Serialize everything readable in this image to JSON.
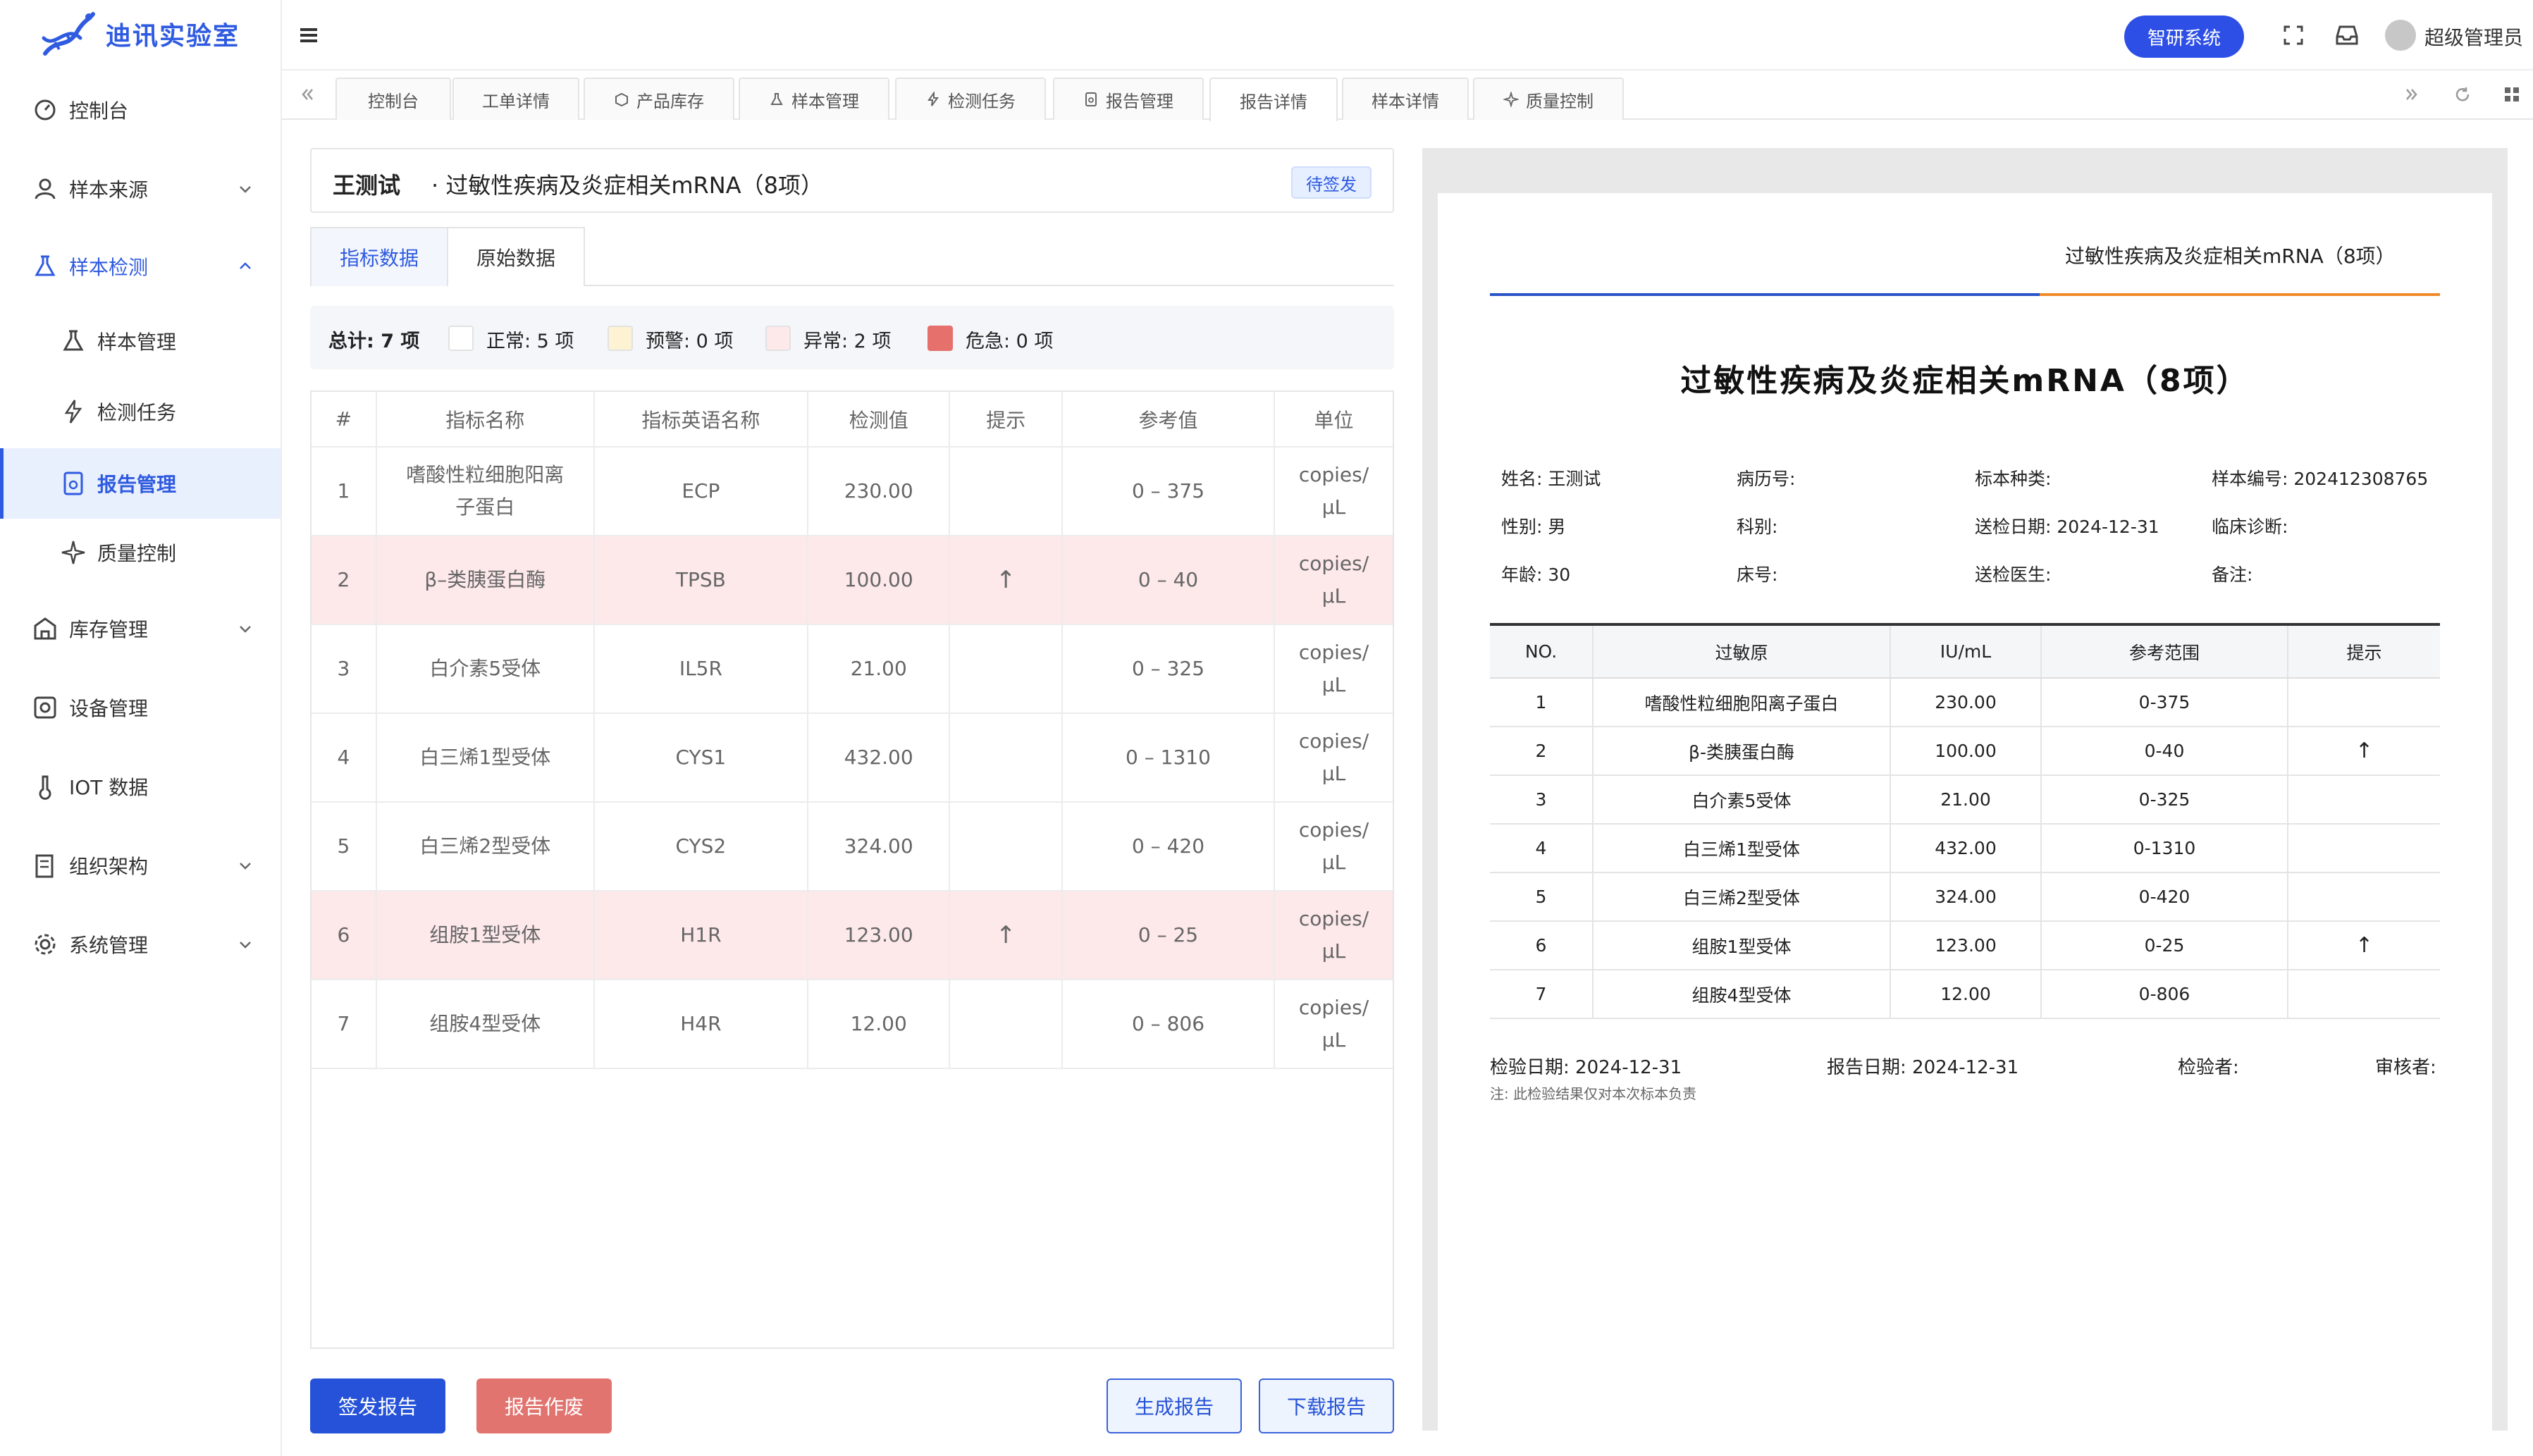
{
  "app": {
    "name": "迪讯实验室"
  },
  "sidebar": {
    "items": [
      {
        "label": "控制台",
        "icon": "dashboard-icon"
      },
      {
        "label": "样本来源",
        "icon": "user-icon",
        "chevron": "down"
      },
      {
        "label": "样本检测",
        "icon": "flask-icon",
        "chevron": "up"
      },
      {
        "label": "样本管理",
        "icon": "flask-icon",
        "sub": true
      },
      {
        "label": "检测任务",
        "icon": "lightning-icon",
        "sub": true
      },
      {
        "label": "报告管理",
        "icon": "report-icon",
        "sub": true,
        "active": true
      },
      {
        "label": "质量控制",
        "icon": "sparkle-icon",
        "sub": true
      },
      {
        "label": "库存管理",
        "icon": "box-icon",
        "chevron": "down"
      },
      {
        "label": "设备管理",
        "icon": "device-icon"
      },
      {
        "label": "IOT 数据",
        "icon": "thermometer-icon"
      },
      {
        "label": "组织架构",
        "icon": "building-icon",
        "chevron": "down"
      },
      {
        "label": "系统管理",
        "icon": "gear-icon",
        "chevron": "down"
      }
    ]
  },
  "topbar": {
    "brand_button": "智研系统",
    "user": "超级管理员"
  },
  "tabs": [
    {
      "label": "控制台"
    },
    {
      "label": "工单详情"
    },
    {
      "label": "产品库存"
    },
    {
      "label": "样本管理"
    },
    {
      "label": "检测任务"
    },
    {
      "label": "报告管理"
    },
    {
      "label": "报告详情",
      "active": true
    },
    {
      "label": "样本详情"
    },
    {
      "label": "质量控制"
    }
  ],
  "report": {
    "patient": "王测试",
    "title": "· 过敏性疾病及炎症相关mRNA（8项）",
    "status": "待签发"
  },
  "subtabs": [
    "指标数据",
    "原始数据"
  ],
  "summary": {
    "total": "总计: 7 项",
    "normal": "正常: 5 项",
    "warning": "预警: 0 项",
    "abnormal": "异常: 2 项",
    "critical": "危急: 0 项",
    "colors": {
      "normal": "#ffffff",
      "warning": "#fdf3d3",
      "abnormal": "#fde8ea",
      "critical": "#e5706c"
    }
  },
  "table": {
    "headers": [
      "#",
      "指标名称",
      "指标英语名称",
      "检测值",
      "提示",
      "参考值",
      "单位"
    ],
    "rows": [
      [
        "1",
        "嗜酸性粒细胞阳离子蛋白",
        "ECP",
        "230.00",
        "",
        "0 – 375",
        "copies/μL"
      ],
      [
        "2",
        "β–类胰蛋白酶",
        "TPSB",
        "100.00",
        "↑",
        "0 – 40",
        "copies/μL"
      ],
      [
        "3",
        "白介素5受体",
        "IL5R",
        "21.00",
        "",
        "0 – 325",
        "copies/μL"
      ],
      [
        "4",
        "白三烯1型受体",
        "CYS1",
        "432.00",
        "",
        "0 – 1310",
        "copies/μL"
      ],
      [
        "5",
        "白三烯2型受体",
        "CYS2",
        "324.00",
        "",
        "0 – 420",
        "copies/μL"
      ],
      [
        "6",
        "组胺1型受体",
        "H1R",
        "123.00",
        "↑",
        "0 – 25",
        "copies/μL"
      ],
      [
        "7",
        "组胺4型受体",
        "H4R",
        "12.00",
        "",
        "0 – 806",
        "copies/μL"
      ]
    ]
  },
  "buttons": {
    "sign": "签发报告",
    "void": "报告作废",
    "generate": "生成报告",
    "download": "下载报告"
  },
  "preview": {
    "header_title": "过敏性疾病及炎症相关mRNA（8项）",
    "title": "过敏性疾病及炎症相关mRNA（8项）",
    "info": [
      [
        "姓名: 王测试",
        "病历号:",
        "标本种类:",
        "样本编号: 202412308765"
      ],
      [
        "性别: 男",
        "科别:",
        "送检日期: 2024-12-31",
        "临床诊断:"
      ],
      [
        "年龄: 30",
        "床号:",
        "送检医生:",
        "备注:"
      ]
    ],
    "headers": [
      "NO.",
      "过敏原",
      "IU/mL",
      "参考范围",
      "提示"
    ],
    "rows": [
      [
        "1",
        "嗜酸性粒细胞阳离子蛋白",
        "230.00",
        "0-375",
        ""
      ],
      [
        "2",
        "β-类胰蛋白酶",
        "100.00",
        "0-40",
        "↑"
      ],
      [
        "3",
        "白介素5受体",
        "21.00",
        "0-325",
        ""
      ],
      [
        "4",
        "白三烯1型受体",
        "432.00",
        "0-1310",
        ""
      ],
      [
        "5",
        "白三烯2型受体",
        "324.00",
        "0-420",
        ""
      ],
      [
        "6",
        "组胺1型受体",
        "123.00",
        "0-25",
        "↑"
      ],
      [
        "7",
        "组胺4型受体",
        "12.00",
        "0-806",
        ""
      ]
    ],
    "footer": {
      "test_date": "检验日期: 2024-12-31",
      "report_date": "报告日期: 2024-12-31",
      "tester": "检验者:",
      "reviewer": "审核者:",
      "note": "注: 此检验结果仅对本次标本负责"
    }
  }
}
